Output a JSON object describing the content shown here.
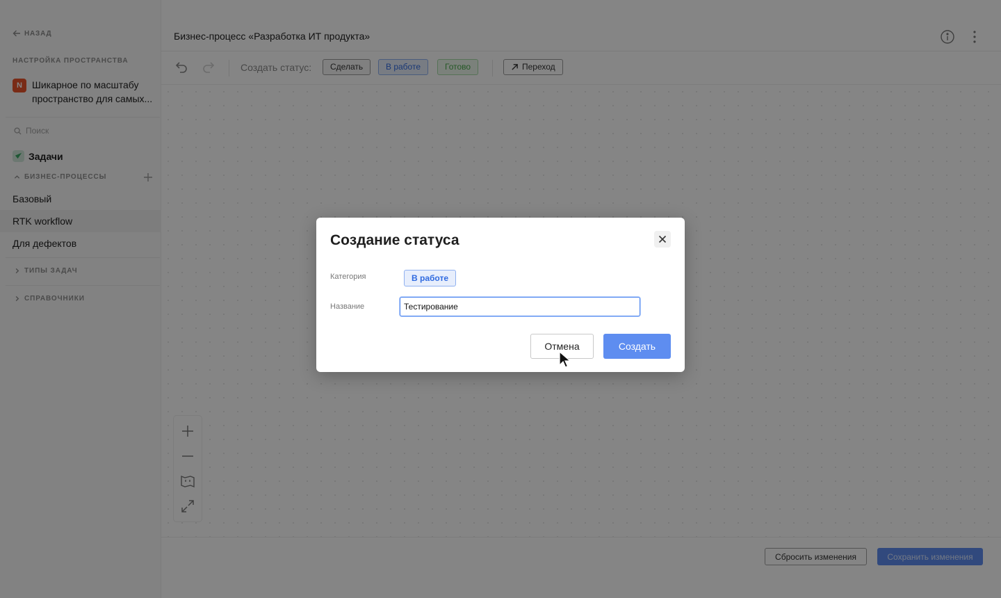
{
  "sidebar": {
    "back_label": "НАЗАД",
    "section_title": "НАСТРОЙКА ПРОСТРАНСТВА",
    "space": {
      "badge": "N",
      "name": "Шикарное по масштабу пространство для самых..."
    },
    "search_placeholder": "Поиск",
    "tasks_label": "Задачи",
    "processes_header": "БИЗНЕС-ПРОЦЕССЫ",
    "processes": [
      "Базовый",
      "RTK workflow",
      "Для дефектов"
    ],
    "active_process": "RTK workflow",
    "task_types_header": "ТИПЫ ЗАДАЧ",
    "directories_header": "СПРАВОЧНИКИ"
  },
  "header": {
    "title": "Бизнес-процесс «Разработка ИТ продукта»"
  },
  "toolbar": {
    "create_status_label": "Создать статус:",
    "chips": {
      "todo": "Сделать",
      "in_progress": "В работе",
      "done": "Готово"
    },
    "transition_label": "Переход"
  },
  "footer": {
    "reset_label": "Сбросить изменения",
    "save_label": "Сохранить изменения"
  },
  "modal": {
    "title": "Создание статуса",
    "category_label": "Категория",
    "category_value": "В работе",
    "name_label": "Название",
    "name_value": "Тестирование",
    "cancel_label": "Отмена",
    "create_label": "Создать"
  },
  "colors": {
    "accent": "#5e8df0",
    "in_progress_chip": "#2f6ae0",
    "done_chip": "#47a94a",
    "space_badge": "#e8542b"
  }
}
